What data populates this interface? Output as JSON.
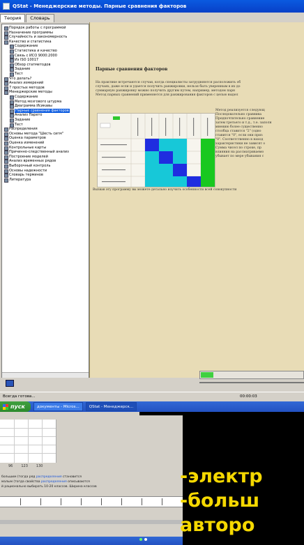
{
  "window": {
    "title": "QStat - Менеджерские методы. Парные сравнения факторов",
    "tabs": [
      {
        "label": "Теория"
      },
      {
        "label": "Словарь"
      }
    ]
  },
  "tree": {
    "items": [
      {
        "label": "Порядок работы с программой",
        "indent": 0,
        "selected": false
      },
      {
        "label": "Назначение программы",
        "indent": 0,
        "selected": false
      },
      {
        "label": "Случайность и закономерность",
        "indent": 0,
        "selected": false
      },
      {
        "label": "Качество и статистика",
        "indent": 0,
        "selected": false
      },
      {
        "label": "Содержание",
        "indent": 1,
        "selected": false
      },
      {
        "label": "Статистика и качество",
        "indent": 1,
        "selected": false
      },
      {
        "label": "Связь с ИСО 9000:2000",
        "indent": 1,
        "selected": false
      },
      {
        "label": "Из ISO 10017",
        "indent": 1,
        "selected": false
      },
      {
        "label": "Обзор статметодов",
        "indent": 1,
        "selected": false
      },
      {
        "label": "Задание",
        "indent": 1,
        "selected": false
      },
      {
        "label": "Тест",
        "indent": 1,
        "selected": false
      },
      {
        "label": "Что делать?",
        "indent": 0,
        "selected": false
      },
      {
        "label": "Анализ измерений",
        "indent": 0,
        "selected": false
      },
      {
        "label": "7 простых методов",
        "indent": 0,
        "selected": false
      },
      {
        "label": "Менеджерские методы",
        "indent": 0,
        "selected": false
      },
      {
        "label": "Содержание",
        "indent": 1,
        "selected": false
      },
      {
        "label": "Метод мозгового штурма",
        "indent": 1,
        "selected": false
      },
      {
        "label": "Диаграмма Исикавы",
        "indent": 1,
        "selected": false
      },
      {
        "label": "Парные сравнения факторов",
        "indent": 1,
        "selected": true
      },
      {
        "label": "Анализ Парето",
        "indent": 1,
        "selected": false
      },
      {
        "label": "Задание",
        "indent": 1,
        "selected": false
      },
      {
        "label": "Тест",
        "indent": 1,
        "selected": false
      },
      {
        "label": "Распределения",
        "indent": 0,
        "selected": false
      },
      {
        "label": "Основы метода \"Шесть сигм\"",
        "indent": 0,
        "selected": false
      },
      {
        "label": "Оценка параметров",
        "indent": 0,
        "selected": false
      },
      {
        "label": "Оценка изменений",
        "indent": 0,
        "selected": false
      },
      {
        "label": "Контрольные карты",
        "indent": 0,
        "selected": false
      },
      {
        "label": "Причинно-следственный анализ",
        "indent": 0,
        "selected": false
      },
      {
        "label": "Построение моделей",
        "indent": 0,
        "selected": false
      },
      {
        "label": "Анализ временных рядов",
        "indent": 0,
        "selected": false
      },
      {
        "label": "Выборочный контроль",
        "indent": 0,
        "selected": false
      },
      {
        "label": "Основы надежности",
        "indent": 0,
        "selected": false
      },
      {
        "label": "Словарь терминов",
        "indent": 0,
        "selected": false
      },
      {
        "label": "Литература",
        "indent": 0,
        "selected": false
      }
    ]
  },
  "content": {
    "heading": "Парные сравнения факторов",
    "paragraphs": [
      "На практике встречаются случаи, когда специалисты затрудняются расположить об",
      "случаях, даже если и удается получить ранжировки, нельзя быть уверенным в их до",
      "суммарную ранжировку можно получить другим путем, например, методом парн",
      "Метод парных сравнений применяется для ранжирования факторов с целью выдел"
    ],
    "side_paragraph": [
      "Метод реализуется следующ",
      "Последовательно сравнива",
      "Предпочтительно сравнение",
      "затем третьего и т.д., т.е. заполн",
      "мнению более существенно",
      "столбца ставится \"2\" (одно",
      "ставится \"0\", если они приз",
      "\"0\". Соответственно в наход",
      "характеристики не зависят о",
      "Сумма чисел по строке, пр",
      "влияния на рассматриваемо",
      "убывает по мере убывания с"
    ],
    "footer_paragraph": "Вызвав эту программу вы можете детально изучить особенности всей совокупности"
  },
  "player": {
    "progress_fraction": 0.12,
    "time": "00:00:03"
  },
  "statusbar": {
    "left": "Всегда готова...",
    "right": "00:00:03"
  },
  "taskbar": {
    "start_label": "пуск",
    "buttons": [
      {
        "label": "документы - Micros..."
      },
      {
        "label": "QStat - Менеджерск..."
      }
    ]
  },
  "lower": {
    "axis_numbers": [
      "96",
      "123",
      "130"
    ],
    "lines": [
      "большим (тогда ряд распределения становится",
      "малым (тогда свойства распределения описываются",
      "й рационально выбирать 10-20 классов. Ширина классов"
    ],
    "highlight_word": "распределения"
  },
  "overlay": {
    "lines": [
      "-электр",
      "-больш",
      "авторо"
    ]
  },
  "colors": {
    "accent": "#0a5ae0",
    "content_bg": "#e8dcb6",
    "overlay_text": "#f5d800",
    "matrix_blue": "#1f2de0",
    "matrix_cyan": "#17c8d8",
    "matrix_green": "#19c81f"
  }
}
